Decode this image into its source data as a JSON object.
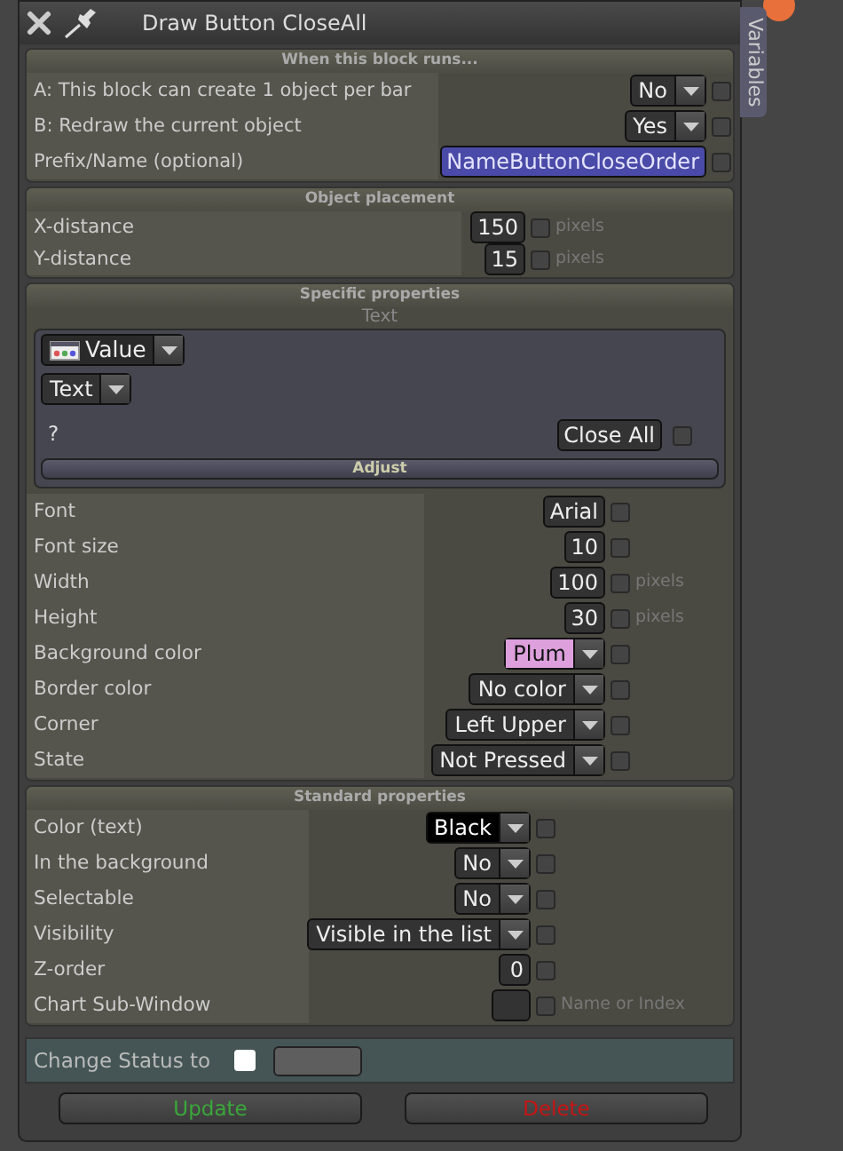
{
  "window": {
    "title": "Draw Button CloseAll"
  },
  "side_tab": {
    "label": "Variables"
  },
  "sections": [
    {
      "title": "When this block runs...",
      "rows": [
        {
          "label": "A: This block can create 1 object per bar",
          "kind": "dropdown",
          "value": "No",
          "checked": false
        },
        {
          "label": "B: Redraw the current object",
          "kind": "dropdown",
          "value": "Yes",
          "checked": false
        },
        {
          "label": "Prefix/Name (optional)",
          "kind": "input",
          "value": "NameButtonCloseOrder",
          "color": "#4a4aa8",
          "checked": false
        }
      ]
    },
    {
      "title": "Object placement",
      "rows": [
        {
          "label": "X-distance",
          "kind": "input",
          "value": "150",
          "checked": false,
          "unit": "pixels"
        },
        {
          "label": "Y-distance",
          "kind": "input",
          "value": "15",
          "checked": false,
          "unit": "pixels"
        }
      ]
    },
    {
      "title": "Specific properties",
      "subpanel": {
        "title": "Text",
        "source": "Value",
        "type": "Text",
        "prompt": "?",
        "text_value": "Close All",
        "checked": false,
        "adjust_button": "Adjust"
      },
      "rows": [
        {
          "label": "Font",
          "kind": "input",
          "value": "Arial",
          "checked": false
        },
        {
          "label": "Font size",
          "kind": "input",
          "value": "10",
          "checked": false
        },
        {
          "label": "Width",
          "kind": "input",
          "value": "100",
          "checked": false,
          "unit": "pixels"
        },
        {
          "label": "Height",
          "kind": "input",
          "value": "30",
          "checked": false,
          "unit": "pixels"
        },
        {
          "label": "Background color",
          "kind": "dropdown",
          "value": "Plum",
          "color": "#dda0dd",
          "checked": false
        },
        {
          "label": "Border color",
          "kind": "dropdown",
          "value": "No color",
          "checked": false
        },
        {
          "label": "Corner",
          "kind": "dropdown",
          "value": "Left Upper",
          "checked": false
        },
        {
          "label": "State",
          "kind": "dropdown",
          "value": "Not Pressed",
          "checked": false
        }
      ]
    },
    {
      "title": "Standard properties",
      "rows": [
        {
          "label": "Color (text)",
          "kind": "dropdown",
          "value": "Black",
          "color": "#000000",
          "checked": false
        },
        {
          "label": "In the background",
          "kind": "dropdown",
          "value": "No",
          "checked": false
        },
        {
          "label": "Selectable",
          "kind": "dropdown",
          "value": "No",
          "checked": false
        },
        {
          "label": "Visibility",
          "kind": "dropdown",
          "value": "Visible in the list",
          "checked": false
        },
        {
          "label": "Z-order",
          "kind": "input",
          "value": "0",
          "checked": false
        },
        {
          "label": "Chart Sub-Window",
          "kind": "input",
          "checked": false,
          "unit": "Name or Index"
        }
      ]
    }
  ],
  "status": {
    "label": "Change Status to",
    "checked": false
  },
  "buttons": [
    {
      "label": "Update",
      "kind": "confirm"
    },
    {
      "label": "Delete",
      "kind": "danger"
    }
  ]
}
